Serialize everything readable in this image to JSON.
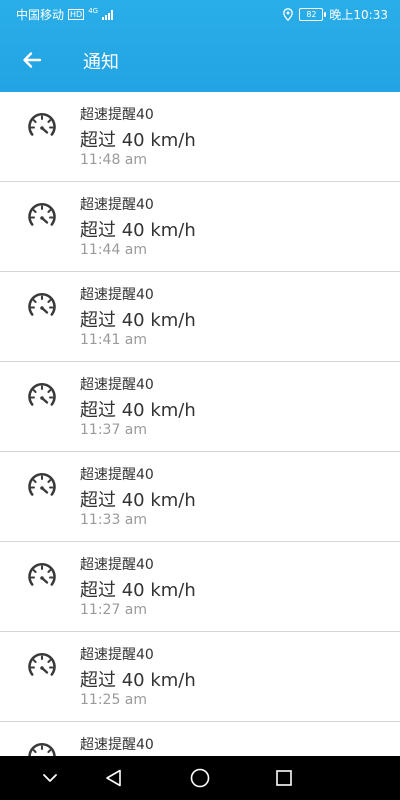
{
  "status_bar": {
    "carrier": "中国移动",
    "hd": "HD",
    "network": "4G",
    "battery": "82",
    "time": "晚上10:33"
  },
  "app_bar": {
    "title": "通知"
  },
  "notifications": [
    {
      "title": "超速提醒40",
      "desc": "超过 40 km/h",
      "time": "11:48 am"
    },
    {
      "title": "超速提醒40",
      "desc": "超过 40 km/h",
      "time": "11:44 am"
    },
    {
      "title": "超速提醒40",
      "desc": "超过 40 km/h",
      "time": "11:41 am"
    },
    {
      "title": "超速提醒40",
      "desc": "超过 40 km/h",
      "time": "11:37 am"
    },
    {
      "title": "超速提醒40",
      "desc": "超过 40 km/h",
      "time": "11:33 am"
    },
    {
      "title": "超速提醒40",
      "desc": "超过 40 km/h",
      "time": "11:27 am"
    },
    {
      "title": "超速提醒40",
      "desc": "超过 40 km/h",
      "time": "11:25 am"
    },
    {
      "title": "超速提醒40",
      "desc": "",
      "time": ""
    }
  ],
  "icons": {
    "back": "arrow-left-icon",
    "notification": "speedometer-icon",
    "nav_collapse": "chevron-down-icon",
    "nav_back": "triangle-back-icon",
    "nav_home": "circle-home-icon",
    "nav_recents": "square-recents-icon"
  },
  "colors": {
    "header": "#22a3e3",
    "divider": "#d6d6d6",
    "text_primary": "#333333",
    "text_secondary": "#9a9a9a",
    "nav_bar": "#000000"
  }
}
